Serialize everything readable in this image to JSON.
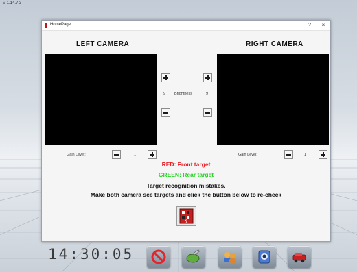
{
  "app": {
    "version": "V 1.14.7.3"
  },
  "dialog": {
    "title": "HomePage",
    "help_label": "?",
    "close_label": "×"
  },
  "left_camera": {
    "title": "LEFT CAMERA",
    "gain_label": "Gain Level:",
    "gain_value": "1"
  },
  "right_camera": {
    "title": "RIGHT CAMERA",
    "gain_label": "Gain Level:",
    "gain_value": "1"
  },
  "brightness": {
    "label": "Brightness",
    "left_value": "9",
    "right_value": "9"
  },
  "messages": {
    "red": "RED: Front target",
    "green": "GREEN: Rear target",
    "line1": "Target recognition mistakes.",
    "line2": "Make both camera see targets and click the button below to re-check"
  },
  "colors": {
    "red_text": "#e8232a",
    "green_text": "#2bd22b",
    "app_icon": "#c3161c"
  },
  "clock": {
    "time": "14:30:05"
  },
  "dock": {
    "icons": [
      "stop-icon",
      "wrench-icon",
      "users-icon",
      "camera-icon",
      "car-lift-icon"
    ]
  }
}
